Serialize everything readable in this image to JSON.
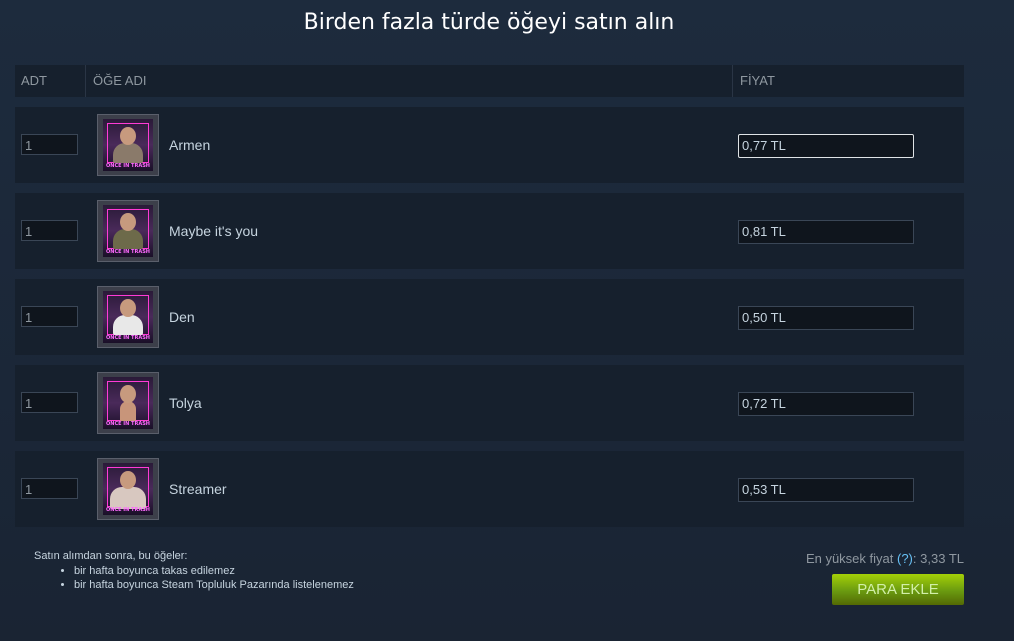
{
  "title": "Birden fazla türde öğeyi satın alın",
  "columns": {
    "qty": "ADT",
    "name": "ÖĞE ADI",
    "price": "FİYAT"
  },
  "items": [
    {
      "qty": "1",
      "name": "Armen",
      "price": "0,77 TL",
      "card_caption": "ONCE IN TRASH"
    },
    {
      "qty": "1",
      "name": "Maybe it's you",
      "price": "0,81 TL",
      "card_caption": "ONCE IN TRASH"
    },
    {
      "qty": "1",
      "name": "Den",
      "price": "0,50 TL",
      "card_caption": "ONCE IN TRASH"
    },
    {
      "qty": "1",
      "name": "Tolya",
      "price": "0,72 TL",
      "card_caption": "ONCE IN TRASH"
    },
    {
      "qty": "1",
      "name": "Streamer",
      "price": "0,53 TL",
      "card_caption": "ONCE IN TRASH"
    }
  ],
  "notes": {
    "intro": "Satın alımdan sonra, bu öğeler:",
    "bullets": [
      "bir hafta boyunca takas edilemez",
      "bir hafta boyunca Steam Topluluk Pazarında listelenemez"
    ]
  },
  "total": {
    "label": "En yüksek fiyat",
    "help": "(?)",
    "sep": ":",
    "value": "3,33 TL"
  },
  "add_button": "PARA EKLE",
  "colors": {
    "accent": "#a4d007",
    "help_link": "#66c0f4",
    "card_frame": "#ff3bd6"
  }
}
